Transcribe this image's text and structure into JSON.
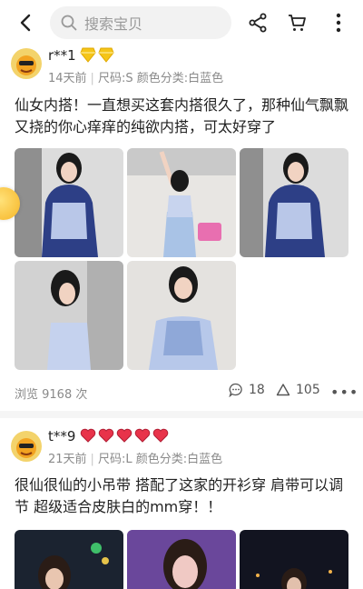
{
  "search": {
    "placeholder": "搜索宝贝"
  },
  "posts": [
    {
      "user": "r**1",
      "badge_type": "diamond",
      "badge_count": 2,
      "time": "14天前",
      "size": "尺码:S",
      "color": "颜色分类:白蓝色",
      "text": "仙女内搭！一直想买这套内搭很久了，那种仙气飘飘又挠的你心痒痒的纯欲内搭，可太好穿了",
      "image_count": 5,
      "views": "浏览 9168 次",
      "comments": "18",
      "likes": "105"
    },
    {
      "user": "t**9",
      "badge_type": "heart",
      "badge_count": 5,
      "time": "21天前",
      "size": "尺码:L",
      "color": "颜色分类:白蓝色",
      "text": "很仙很仙的小吊带 搭配了这家的开衫穿 肩带可以调节 超级适合皮肤白的mm穿！！",
      "image_count": 3
    }
  ],
  "colors": {
    "diamond": "#f5c518",
    "heart": "#e8334a",
    "accent": "#ff5000"
  },
  "icons": [
    "back-icon",
    "search-icon",
    "share-icon",
    "cart-icon",
    "more-icon",
    "comment-icon",
    "like-icon"
  ]
}
